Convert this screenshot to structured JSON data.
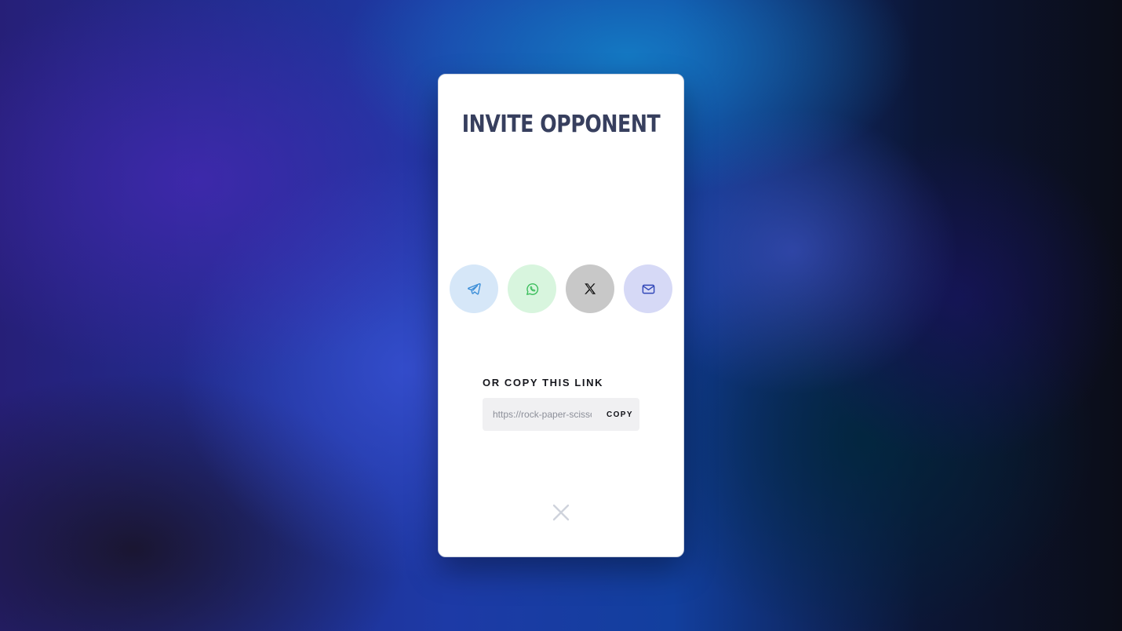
{
  "modal": {
    "title": "INVITE OPPONENT",
    "share_buttons": [
      {
        "name": "telegram",
        "icon": "telegram-icon",
        "bg": "#d6e7f8",
        "color": "#3b8ed8"
      },
      {
        "name": "whatsapp",
        "icon": "whatsapp-icon",
        "bg": "#d8f5de",
        "color": "#3fbf5f"
      },
      {
        "name": "x",
        "icon": "x-logo-icon",
        "bg": "#c8c8c8",
        "color": "#111111"
      },
      {
        "name": "email",
        "icon": "mail-icon",
        "bg": "#d6d9f6",
        "color": "#3146b8"
      }
    ],
    "copy_section": {
      "label": "OR COPY THIS LINK",
      "link_value": "https://rock-paper-scissors",
      "copy_button_label": "COPY"
    },
    "close_icon": "close-icon"
  },
  "colors": {
    "title": "#373f5e",
    "close_icon": "#cfd3dc"
  }
}
